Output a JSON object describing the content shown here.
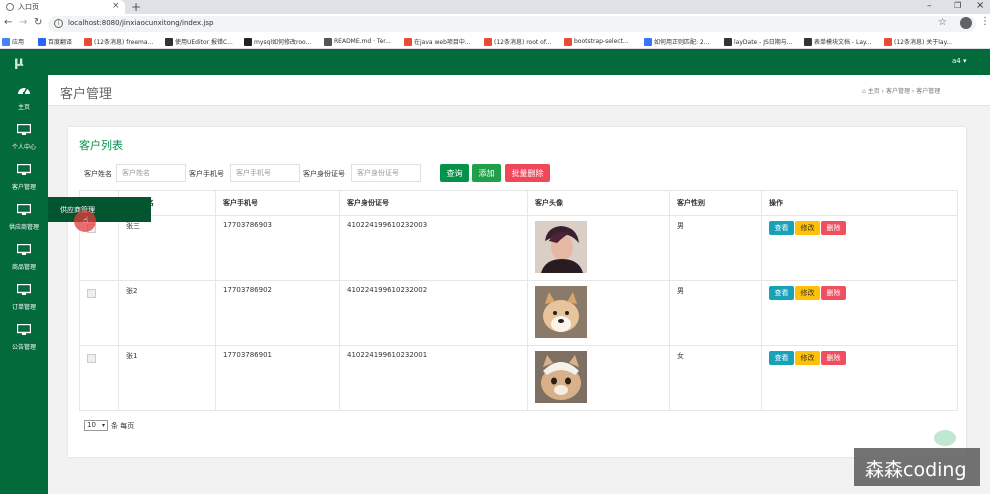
{
  "browser": {
    "tab_title": "入口页",
    "url": "localhost:8080/jinxiaocunxitong/index.jsp",
    "bookmarks": [
      {
        "label": "应用",
        "color": "#4285f4"
      },
      {
        "label": "百度翻译",
        "color": "#2468f2"
      },
      {
        "label": "(12条消息) freema...",
        "color": "#e84b3c"
      },
      {
        "label": "使用UEditor 报错C...",
        "color": "#333333"
      },
      {
        "label": "mysql如何修改roo...",
        "color": "#222222"
      },
      {
        "label": "README.md · Ter...",
        "color": "#555555"
      },
      {
        "label": "在java web项目中...",
        "color": "#e84b3c"
      },
      {
        "label": "(12条消息) root of...",
        "color": "#e84b3c"
      },
      {
        "label": "bootstrap-select...",
        "color": "#e84b3c"
      },
      {
        "label": "如何用正则匹配: 2...",
        "color": "#3478f6"
      },
      {
        "label": "layDate - JS日期与...",
        "color": "#333333"
      },
      {
        "label": "表单模块文档 - Lay...",
        "color": "#333333"
      },
      {
        "label": "(12条消息) 关于lay...",
        "color": "#e84b3c"
      }
    ]
  },
  "brand": {
    "logo": "μ"
  },
  "user": {
    "name": "a4 ▾"
  },
  "sidebar": {
    "items": [
      {
        "label": "主页"
      },
      {
        "label": "个人中心"
      },
      {
        "label": "客户管理"
      },
      {
        "label": "供应商管理"
      },
      {
        "label": "商品管理"
      },
      {
        "label": "订单管理"
      },
      {
        "label": "公告管理"
      }
    ],
    "tooltip": "供应商管理"
  },
  "page": {
    "title": "客户管理",
    "breadcrumb": [
      "主页",
      "客户管理",
      "客户管理"
    ],
    "panel_title": "客户列表"
  },
  "search": {
    "name_label": "客户姓名",
    "name_placeholder": "客户姓名",
    "phone_label": "客户手机号",
    "phone_placeholder": "客户手机号",
    "id_label": "客户身份证号",
    "id_placeholder": "客户身份证号",
    "query_btn": "查询",
    "add_btn": "添加",
    "batch_delete_btn": "批量删除"
  },
  "table": {
    "columns": [
      "",
      "客户姓名",
      "客户手机号",
      "客户身份证号",
      "客户头像",
      "客户性别",
      "操作"
    ],
    "rows": [
      {
        "name": "张三",
        "phone": "17703786903",
        "id_card": "410224199610232003",
        "gender": "男",
        "avatar": "person"
      },
      {
        "name": "张2",
        "phone": "17703786902",
        "id_card": "410224199610232002",
        "gender": "男",
        "avatar": "dog"
      },
      {
        "name": "张1",
        "phone": "17703786901",
        "id_card": "410224199610232001",
        "gender": "女",
        "avatar": "cat"
      }
    ],
    "actions": {
      "view": "查看",
      "edit": "修改",
      "delete": "删除"
    }
  },
  "pagination": {
    "page_size": "10",
    "suffix": "条 每页"
  },
  "watermark": {
    "text": "森森coding"
  },
  "colors": {
    "primary_green": "#036a3b",
    "query": "#03924a",
    "add": "#21a04a",
    "danger": "#f0475a",
    "view": "#17a2b8",
    "edit": "#ffc107",
    "delete": "#f14f60"
  }
}
